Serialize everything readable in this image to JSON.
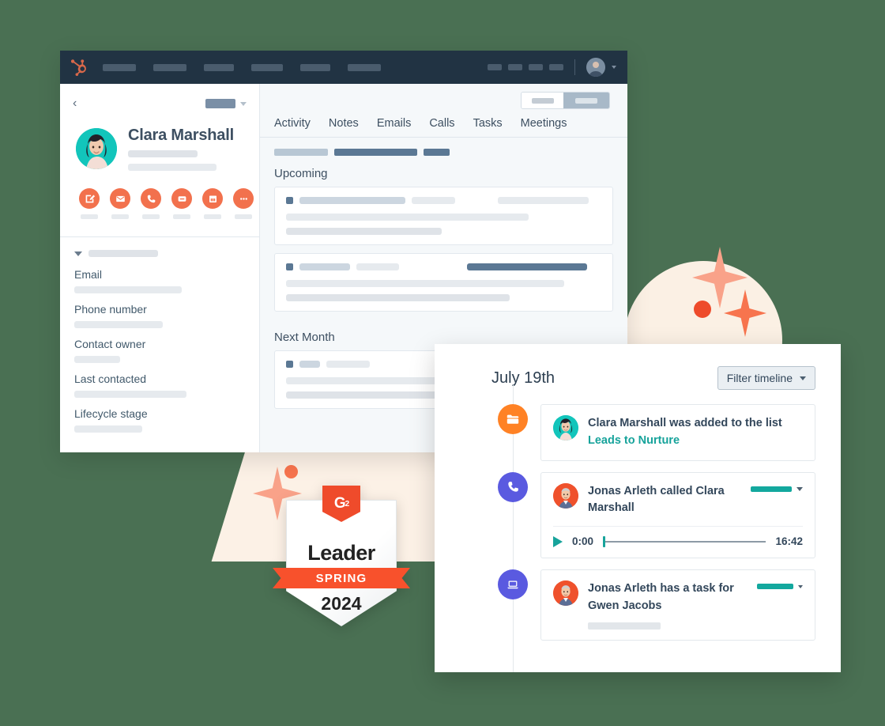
{
  "background": {
    "color": "#4a7053"
  },
  "crm": {
    "navbar": {
      "logo_icon": "hubspot-sprocket-icon",
      "avatar_icon": "user-avatar",
      "caret_icon": "chevron-down-icon"
    },
    "contact": {
      "back_icon": "chevron-left-icon",
      "name": "Clara Marshall",
      "avatar_icon": "contact-avatar",
      "actions": [
        {
          "name": "note-action",
          "icon": "note-edit-icon"
        },
        {
          "name": "email-action",
          "icon": "envelope-icon"
        },
        {
          "name": "call-action",
          "icon": "phone-icon"
        },
        {
          "name": "log-action",
          "icon": "log-icon"
        },
        {
          "name": "meeting-action",
          "icon": "calendar-icon"
        },
        {
          "name": "more-action",
          "icon": "ellipsis-icon"
        }
      ]
    },
    "properties": {
      "collapse_icon": "chevron-down-icon",
      "rows": [
        {
          "label": "Email"
        },
        {
          "label": "Phone number"
        },
        {
          "label": "Contact owner"
        },
        {
          "label": "Last contacted"
        },
        {
          "label": "Lifecycle stage"
        }
      ]
    },
    "tabs": [
      {
        "label": "Activity",
        "active": true
      },
      {
        "label": "Notes",
        "active": false
      },
      {
        "label": "Emails",
        "active": false
      },
      {
        "label": "Calls",
        "active": false
      },
      {
        "label": "Tasks",
        "active": false
      },
      {
        "label": "Meetings",
        "active": false
      }
    ],
    "sections": [
      {
        "title": "Upcoming"
      },
      {
        "title": "Next Month"
      }
    ]
  },
  "badge": {
    "logo_text": "G",
    "logo_sup": "2",
    "title": "Leader",
    "season": "SPRING",
    "year": "2024"
  },
  "timeline": {
    "date": "July 19th",
    "filter_label": "Filter timeline",
    "filter_caret_icon": "chevron-down-icon",
    "items": [
      {
        "icon": "list-folder-icon",
        "icon_color": "#ff8225",
        "avatar": "clara-avatar",
        "text": "Clara Marshall was added to the list ",
        "link_text": "Leads to Nurture",
        "has_status_bar": false
      },
      {
        "icon": "phone-icon",
        "icon_color": "#5a5ae0",
        "avatar": "jonas-avatar",
        "text": "Jonas Arleth called Clara Marshall",
        "has_status_bar": true,
        "player": {
          "play_icon": "play-icon",
          "current_time": "0:00",
          "duration": "16:42"
        }
      },
      {
        "icon": "laptop-task-icon",
        "icon_color": "#5a5ae0",
        "avatar": "jonas-avatar",
        "text": "Jonas Arleth has a task for Gwen Jacobs",
        "has_status_bar": true
      }
    ]
  },
  "colors": {
    "hubspot_orange": "#f2714d",
    "nav_dark": "#213343",
    "teal": "#12c5bb",
    "link_teal": "#17a39b",
    "purple": "#5a5ae0",
    "g2_red": "#ef4b2b"
  }
}
